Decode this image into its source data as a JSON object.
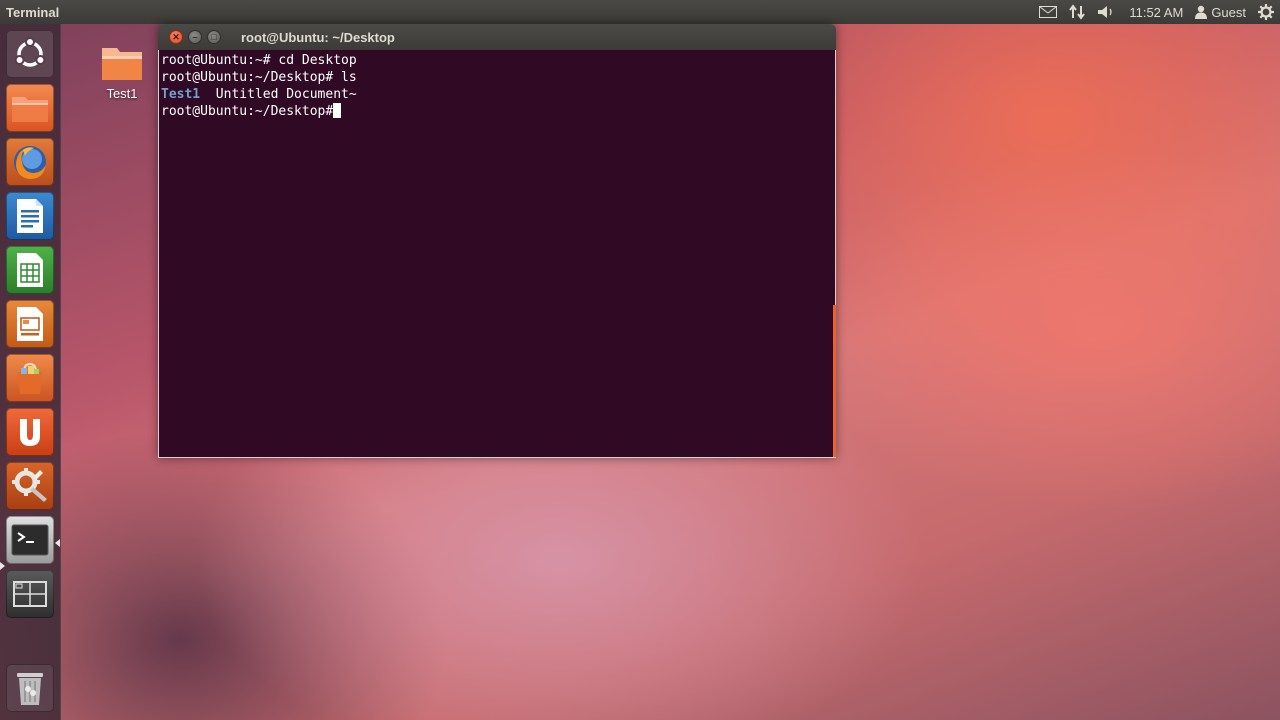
{
  "top_panel": {
    "app_title": "Terminal",
    "clock": "11:52 AM",
    "user": "Guest",
    "indicators": [
      "mail-icon",
      "network-icon",
      "volume-icon",
      "user-icon",
      "gear-icon"
    ]
  },
  "launcher": {
    "items": [
      {
        "name": "dash-home",
        "icon": "ubuntu-logo-icon"
      },
      {
        "name": "home-folder",
        "icon": "folder-icon"
      },
      {
        "name": "firefox",
        "icon": "firefox-icon"
      },
      {
        "name": "libreoffice-writer",
        "icon": "writer-icon"
      },
      {
        "name": "libreoffice-calc",
        "icon": "calc-icon"
      },
      {
        "name": "libreoffice-impress",
        "icon": "impress-icon"
      },
      {
        "name": "software-center",
        "icon": "shopping-bag-icon"
      },
      {
        "name": "ubuntu-one",
        "icon": "ubuntu-one-icon"
      },
      {
        "name": "system-settings",
        "icon": "settings-icon"
      },
      {
        "name": "terminal",
        "icon": "terminal-icon"
      },
      {
        "name": "workspace-switcher",
        "icon": "workspace-icon"
      },
      {
        "name": "trash",
        "icon": "trash-icon"
      }
    ]
  },
  "desktop": {
    "icons": [
      {
        "label": "Test1",
        "icon": "folder-icon"
      }
    ]
  },
  "terminal": {
    "title": "root@Ubuntu: ~/Desktop",
    "lines": [
      {
        "prompt": "root@Ubuntu:~#",
        "command": " cd Desktop"
      },
      {
        "prompt": "root@Ubuntu:~/Desktop#",
        "command": " ls"
      },
      {
        "dir": "Test1",
        "rest": "  Untitled Document~"
      },
      {
        "prompt": "root@Ubuntu:~/Desktop#",
        "command": ""
      }
    ]
  },
  "colors": {
    "terminal_bg": "#300a24",
    "dir_color": "#729fcf",
    "close_button": "#e95420",
    "panel_bg": "#3c3b37"
  }
}
